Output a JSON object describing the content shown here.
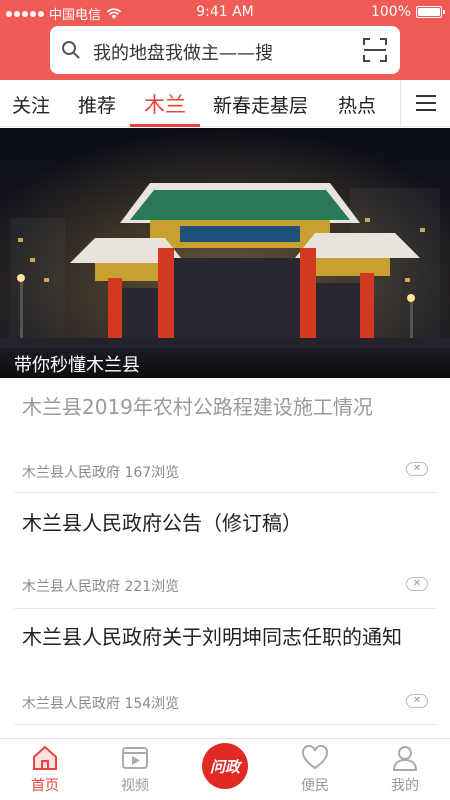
{
  "status_bar": {
    "carrier": "中国电信",
    "time": "9:41 AM",
    "battery": "100%",
    "battery_level": 1.0
  },
  "search": {
    "placeholder": "我的地盘我做主——搜"
  },
  "tabs": [
    {
      "label": "关注",
      "active": false
    },
    {
      "label": "推荐",
      "active": false
    },
    {
      "label": "木兰",
      "active": true
    },
    {
      "label": "新春走基层",
      "active": false
    },
    {
      "label": "热点",
      "active": false
    }
  ],
  "banner": {
    "caption": "带你秒懂木兰县"
  },
  "news": [
    {
      "title": "木兰县2019年农村公路程建设施工情况",
      "meta": "木兰县人民政府 167浏览",
      "read": true
    },
    {
      "title": "木兰县人民政府公告（修订稿）",
      "meta": "木兰县人民政府 221浏览",
      "read": false
    },
    {
      "title": "木兰县人民政府关于刘明坤同志任职的通知",
      "meta": "木兰县人民政府 154浏览",
      "read": false
    }
  ],
  "bottom_nav": {
    "items": [
      {
        "label": "首页",
        "icon": "home-icon",
        "active": true
      },
      {
        "label": "视频",
        "icon": "video-icon",
        "active": false
      },
      {
        "label": "便民",
        "icon": "heart-icon",
        "active": false
      },
      {
        "label": "我的",
        "icon": "user-icon",
        "active": false
      }
    ],
    "center": {
      "label": "问政"
    }
  },
  "colors": {
    "brand_red": "#f05c55",
    "active_red": "#e8433c",
    "center_button": "#e02b24"
  }
}
